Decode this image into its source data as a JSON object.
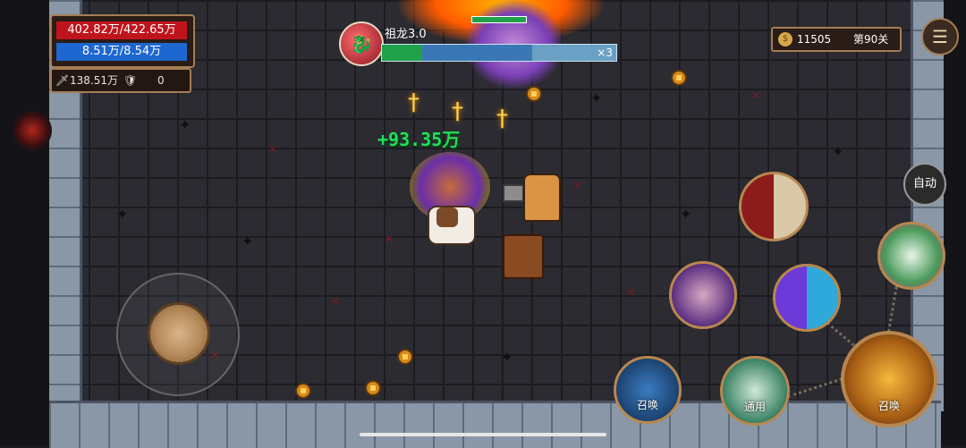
{
  "hud": {
    "hp": "402.82万/422.65万",
    "mp": "8.51万/8.54万",
    "attack": "138.51万",
    "defense": "0"
  },
  "boss": {
    "name": "祖龙3.0",
    "multiplier": "×3",
    "green_fraction": 0.17,
    "blue_fraction": 0.47
  },
  "resources": {
    "coins": "11505",
    "level": "第90关"
  },
  "controls": {
    "auto": "自动",
    "summon_small": "召唤",
    "normal": "通用",
    "summon_big": "召唤"
  },
  "effects": {
    "damage": "+93.35万"
  },
  "icons": [
    "sword-icon",
    "shield-icon",
    "coin-icon",
    "menu-icon",
    "dragon-portrait-icon"
  ],
  "colors": {
    "hp": "#c0141d",
    "mp": "#1e67d0",
    "damage": "#22e05a",
    "frame": "#a57d55"
  }
}
